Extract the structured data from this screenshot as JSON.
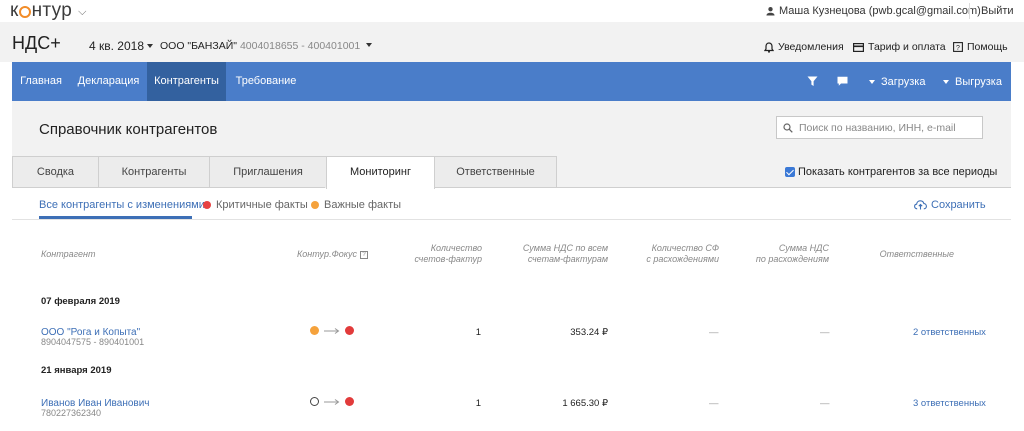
{
  "topbar": {
    "logo_pre": "к",
    "logo_post": "нтур",
    "user": "Маша Кузнецова (pwb.gcal@gmail.com)",
    "logout": "Выйти"
  },
  "header": {
    "product": "НДС+",
    "period": "4 кв. 2018",
    "org_name": "ООО \"БАНЗАЙ\"",
    "org_ids": "4004018655 - 400401001",
    "notifications": "Уведомления",
    "tariff": "Тариф и оплата",
    "help": "Помощь"
  },
  "nav": {
    "items": [
      "Главная",
      "Декларация",
      "Контрагенты",
      "Требование"
    ],
    "active_index": 2,
    "upload": "Загрузка",
    "download": "Выгрузка"
  },
  "page": {
    "title": "Справочник контрагентов",
    "search_placeholder": "Поиск по названию, ИНН, e-mail",
    "tabs": [
      "Сводка",
      "Контрагенты",
      "Приглашения",
      "Мониторинг",
      "Ответственные"
    ],
    "active_tab": 3,
    "show_all_periods": "Показать контрагентов за все периоды",
    "show_all_checked": true
  },
  "filters": {
    "all": "Все контрагенты с изменениями",
    "critical": "Критичные факты",
    "important": "Важные факты",
    "save": "Сохранить"
  },
  "table": {
    "columns": {
      "counterparty": "Контрагент",
      "focus": "Контур.Фокус",
      "invoice_count": [
        "Количество",
        "счетов-фактур"
      ],
      "vat_sum": [
        "Сумма НДС по всем",
        "счетам-фактурам"
      ],
      "discrepancy_count": [
        "Количество СФ",
        "с расхождениями"
      ],
      "discrepancy_vat": [
        "Сумма НДС",
        "по расхождениям"
      ],
      "responsible": "Ответственные"
    },
    "groups": [
      {
        "date": "07 февраля 2019",
        "rows": [
          {
            "name": "ООО \"Рога и Копыта\"",
            "inn": "8904047575 - 890401001",
            "status_from": "orange",
            "status_to": "red",
            "invoice_count": "1",
            "vat_sum": "353.24 ₽",
            "discrepancy_count": "—",
            "discrepancy_vat": "—",
            "responsible": "2 ответственных"
          }
        ]
      },
      {
        "date": "21 января 2019",
        "rows": [
          {
            "name": "Иванов Иван Иванович",
            "inn": "780227362340",
            "status_from": "empty",
            "status_to": "red",
            "invoice_count": "1",
            "vat_sum": "1 665.30 ₽",
            "discrepancy_count": "—",
            "discrepancy_vat": "—",
            "responsible": "3 ответственных"
          }
        ]
      }
    ]
  },
  "colors": {
    "nav": "#4a7dc9",
    "nav_active": "#33619f",
    "link": "#3d6fb6",
    "critical": "#e84141",
    "important": "#f5a23c",
    "logo_accent": "#f28c28"
  }
}
